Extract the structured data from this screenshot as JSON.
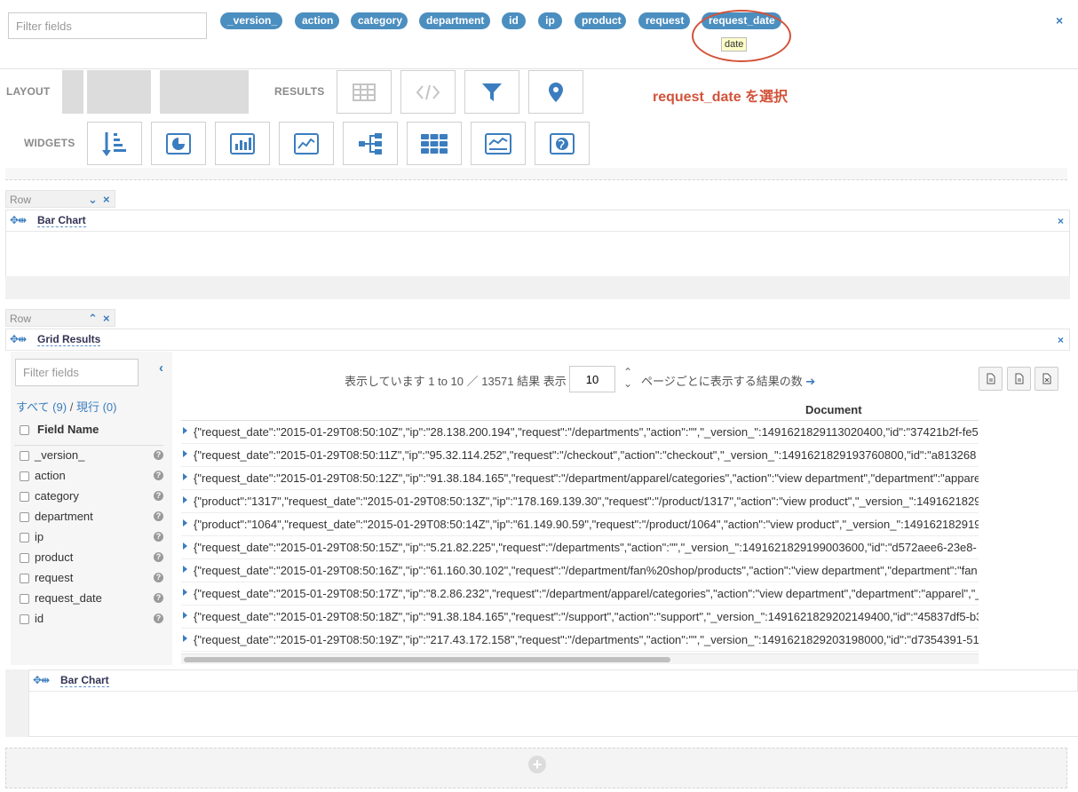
{
  "top_bar": {
    "filter_placeholder": "Filter fields",
    "fields": [
      "_version_",
      "action",
      "category",
      "department",
      "id",
      "ip",
      "product",
      "request",
      "request_date"
    ],
    "tooltip": "date",
    "close_icon": "×"
  },
  "toolbar": {
    "layout_label": "LAYOUT",
    "results_label": "RESULTS",
    "widgets_label": "WIDGETS",
    "annotation": "request_date を選択",
    "result_icons": [
      "grid-icon",
      "code-icon",
      "filter-icon",
      "map-marker-icon"
    ],
    "widget_icons": [
      "sort-amount-icon",
      "pie-chart-icon",
      "bar-chart-icon",
      "line-chart-icon",
      "tree-icon",
      "heatmap-grid-icon",
      "timeline-icon",
      "globe-icon"
    ]
  },
  "row1": {
    "tag": "Row",
    "widget_title": "Bar Chart"
  },
  "row2": {
    "tag": "Row",
    "widget_title": "Grid Results"
  },
  "grid": {
    "filter_placeholder": "Filter fields",
    "select_all": "すべて (9)",
    "separator": "/",
    "select_current": "現行 (0)",
    "field_name_header": "Field Name",
    "fields": [
      "_version_",
      "action",
      "category",
      "department",
      "ip",
      "product",
      "request",
      "request_date",
      "id"
    ],
    "pager": {
      "showing": "表示しています",
      "range": "1 to 10",
      "slash": "／",
      "total": "13571",
      "results": "結果",
      "show": "表示",
      "page_size": "10",
      "per_page": "ページごとに表示する結果の数"
    },
    "document_header": "Document",
    "documents": [
      "{\"request_date\":\"2015-01-29T08:50:10Z\",\"ip\":\"28.138.200.194\",\"request\":\"/departments\",\"action\":\"\",\"_version_\":1491621829113020400,\"id\":\"37421b2f-fe5",
      "{\"request_date\":\"2015-01-29T08:50:11Z\",\"ip\":\"95.32.114.252\",\"request\":\"/checkout\",\"action\":\"checkout\",\"_version_\":1491621829193760800,\"id\":\"a813268",
      "{\"request_date\":\"2015-01-29T08:50:12Z\",\"ip\":\"91.38.184.165\",\"request\":\"/department/apparel/categories\",\"action\":\"view department\",\"department\":\"appare",
      "{\"product\":\"1317\",\"request_date\":\"2015-01-29T08:50:13Z\",\"ip\":\"178.169.139.30\",\"request\":\"/product/1317\",\"action\":\"view product\",\"_version_\":14916218292",
      "{\"product\":\"1064\",\"request_date\":\"2015-01-29T08:50:14Z\",\"ip\":\"61.149.90.59\",\"request\":\"/product/1064\",\"action\":\"view product\",\"_version_\":149162182919",
      "{\"request_date\":\"2015-01-29T08:50:15Z\",\"ip\":\"5.21.82.225\",\"request\":\"/departments\",\"action\":\"\",\"_version_\":1491621829199003600,\"id\":\"d572aee6-23e8-",
      "{\"request_date\":\"2015-01-29T08:50:16Z\",\"ip\":\"61.160.30.102\",\"request\":\"/department/fan%20shop/products\",\"action\":\"view department\",\"department\":\"fan",
      "{\"request_date\":\"2015-01-29T08:50:17Z\",\"ip\":\"8.2.86.232\",\"request\":\"/department/apparel/categories\",\"action\":\"view department\",\"department\":\"apparel\",\"_",
      "{\"request_date\":\"2015-01-29T08:50:18Z\",\"ip\":\"91.38.184.165\",\"request\":\"/support\",\"action\":\"support\",\"_version_\":1491621829202149400,\"id\":\"45837df5-b3",
      "{\"request_date\":\"2015-01-29T08:50:19Z\",\"ip\":\"217.43.172.158\",\"request\":\"/departments\",\"action\":\"\",\"_version_\":1491621829203198000,\"id\":\"d7354391-51"
    ]
  },
  "row3": {
    "widget_title": "Bar Chart"
  },
  "colors": {
    "pill": "#4b8ec0",
    "accent": "#3b7dbf",
    "annotation": "#d2533a"
  }
}
